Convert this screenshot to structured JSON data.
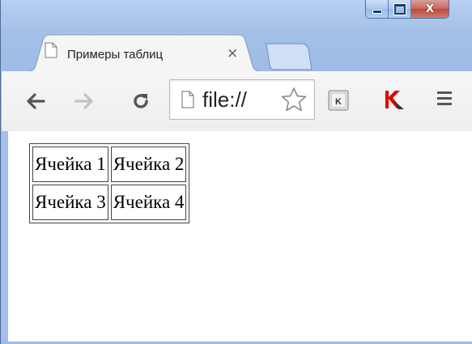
{
  "tab": {
    "title": "Примеры таблиц",
    "close_glyph": "×",
    "page_icon": "page-icon"
  },
  "window_controls": {
    "minimize_icon": "minimize-icon",
    "maximize_icon": "maximize-icon",
    "close_glyph": "X"
  },
  "toolbar": {
    "back_icon": "back-arrow-icon",
    "forward_icon": "forward-arrow-icon",
    "reload_icon": "reload-icon",
    "address_text": "file://",
    "bookmark_icon": "star-icon",
    "extension_k_label": "K",
    "kaspersky_icon": "kaspersky-icon",
    "menu_icon": "hamburger-menu-icon"
  },
  "table": {
    "rows": [
      [
        "Ячейка 1",
        "Ячейка 2"
      ],
      [
        "Ячейка 3",
        "Ячейка 4"
      ]
    ]
  }
}
